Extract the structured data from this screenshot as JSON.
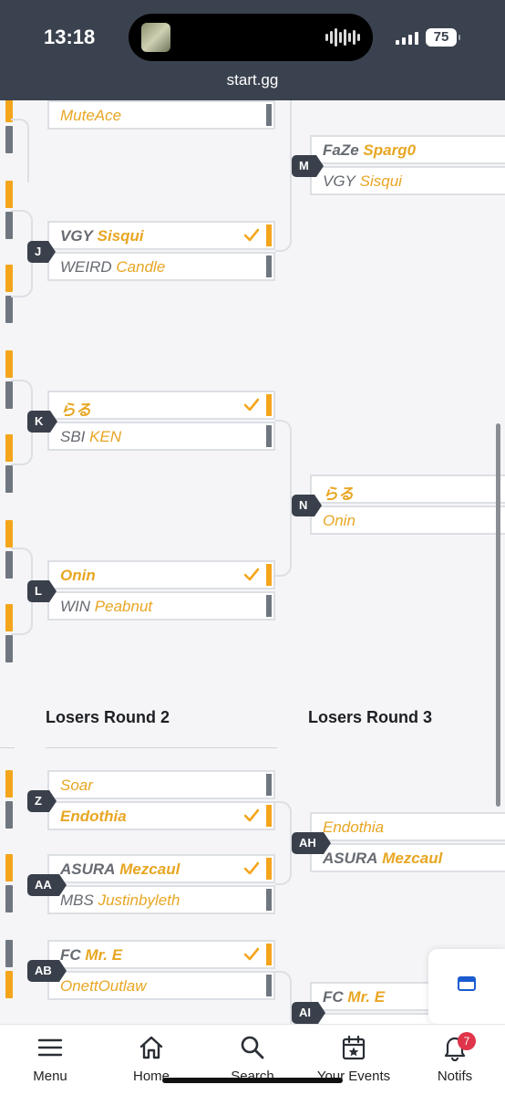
{
  "status_bar": {
    "time": "13:18",
    "battery": "75"
  },
  "browser": {
    "url": "start.gg"
  },
  "bracket": {
    "partial_top_name": "MuteAce",
    "sets": {
      "J": {
        "id": "J",
        "top": {
          "prefix": "VGY",
          "tag": "Sisqui"
        },
        "bottom": {
          "prefix": "WEIRD",
          "tag": "Candle"
        }
      },
      "K": {
        "id": "K",
        "top": {
          "prefix": "",
          "tag": "らる"
        },
        "bottom": {
          "prefix": "SBI",
          "tag": "KEN"
        }
      },
      "L": {
        "id": "L",
        "top": {
          "prefix": "",
          "tag": "Onin"
        },
        "bottom": {
          "prefix": "WIN",
          "tag": "Peabnut"
        }
      },
      "M": {
        "id": "M",
        "top": {
          "prefix": "FaZe",
          "tag": "Sparg0"
        },
        "bottom": {
          "prefix": "VGY",
          "tag": "Sisqui"
        }
      },
      "N": {
        "id": "N",
        "top": {
          "prefix": "",
          "tag": "らる"
        },
        "bottom": {
          "prefix": "",
          "tag": "Onin"
        }
      },
      "Z": {
        "id": "Z",
        "top": {
          "prefix": "",
          "tag": "Soar"
        },
        "bottom": {
          "prefix": "",
          "tag": "Endothia"
        }
      },
      "AA": {
        "id": "AA",
        "top": {
          "prefix": "ASURA",
          "tag": "Mezcaul"
        },
        "bottom": {
          "prefix": "MBS",
          "tag": "Justinbyleth"
        }
      },
      "AB": {
        "id": "AB",
        "top": {
          "prefix": "FC",
          "tag": "Mr. E"
        },
        "bottom": {
          "prefix": "",
          "tag": "OnettOutlaw"
        }
      },
      "AH": {
        "id": "AH",
        "top": {
          "prefix": "",
          "tag": "Endothia"
        },
        "bottom": {
          "prefix": "ASURA",
          "tag": "Mezcaul"
        }
      },
      "AI": {
        "id": "AI",
        "top": {
          "prefix": "FC",
          "tag": "Mr. E"
        }
      }
    },
    "rounds": {
      "losers_round_2": "Losers Round 2",
      "losers_round_3": "Losers Round 3"
    }
  },
  "bottom_nav": {
    "menu": "Menu",
    "home": "Home",
    "search": "Search",
    "your_events": "Your Events",
    "notifs": "Notifs",
    "notif_count": "7"
  },
  "colors": {
    "accent": "#f4a51c",
    "header": "#3b424f",
    "loser": "#6f7680",
    "badge": "#e0344a"
  }
}
